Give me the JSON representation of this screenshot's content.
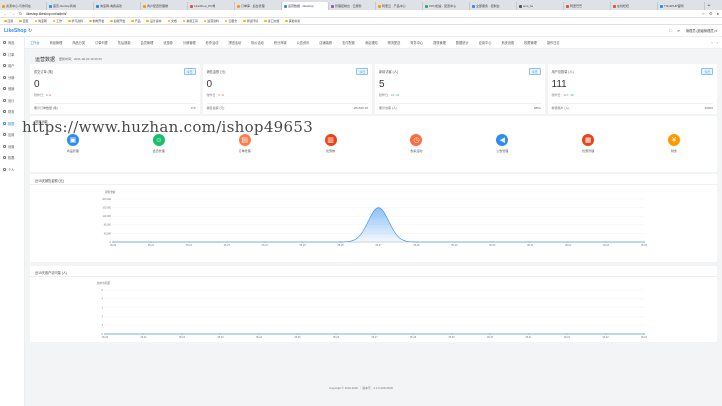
{
  "browser": {
    "tabs": [
      {
        "title": "资源中心-与你同在",
        "color": "#f39c12"
      },
      {
        "title": "首页-Ifoshop商城",
        "color": "#2d8cf0"
      },
      {
        "title": "淘宝网-淘我喜欢",
        "color": "#1e88e5"
      },
      {
        "title": "商户配置管理端",
        "color": "#f39c12"
      },
      {
        "title": "LikeShop_PC端",
        "color": "#e74c3c"
      },
      {
        "title": "订单库 · 后台管理",
        "color": "#f39c12"
      },
      {
        "title": "运营数据 · likeshop",
        "color": "#2d8cf0",
        "active": true
      },
      {
        "title": "管理控制台 · 云服务",
        "color": "#9b59b6"
      },
      {
        "title": "阿里云 · 产品中心",
        "color": "#f39c12"
      },
      {
        "title": "CDN加速 · 配置中心",
        "color": "#27ae60"
      },
      {
        "title": "全部服务 · 控制台",
        "color": "#2d8cf0"
      },
      {
        "title": "sms_fie",
        "color": "#555555"
      },
      {
        "title": "阿里巴巴",
        "color": "#e74c3c"
      },
      {
        "title": "在线旺旺",
        "color": "#e74c3c"
      },
      {
        "title": "ThinkPHP官网",
        "color": "#2d8cf0"
      }
    ],
    "new_tab": "+",
    "url": "likeshop.likeshop.net/admin/",
    "bookmarks": [
      "应用",
      "百度",
      "淘宝网",
      "工作",
      "学习资料",
      "前端开发",
      "后端开发",
      "产品",
      "设计素材",
      "文档",
      "常用工具",
      "运营资料",
      "云服务",
      "测试环境",
      "接口文档",
      "其他书签"
    ]
  },
  "app": {
    "logo": "LikeShop",
    "refresh_icon": "↻",
    "header_right": [
      "⛶",
      "⟳",
      "管理员 (超级管理员) ▾"
    ]
  },
  "sidebar": {
    "items": [
      {
        "label": "商品",
        "active": false
      },
      {
        "label": "订单",
        "active": false
      },
      {
        "label": "用户",
        "active": false
      },
      {
        "label": "分销",
        "active": false
      },
      {
        "label": "营销",
        "active": false
      },
      {
        "label": "设计",
        "active": false
      },
      {
        "label": "财务",
        "active": false
      },
      {
        "label": "数据",
        "active": true
      },
      {
        "label": "应用",
        "active": false
      },
      {
        "label": "设置",
        "active": false
      },
      {
        "label": "权限",
        "active": false
      },
      {
        "label": "个人",
        "active": false
      }
    ]
  },
  "topnav": {
    "items": [
      "工作台",
      "商品管理",
      "商品分类",
      "订单列表",
      "售后退款",
      "会员管理",
      "优惠券",
      "分销管理",
      "秒杀活动",
      "拼团活动",
      "砍价活动",
      "积分商城",
      "公告资讯",
      "店铺装修",
      "支付配置",
      "消息通知",
      "物流配送",
      "财务中心",
      "提现管理",
      "数据统计",
      "应用中心",
      "系统设置",
      "权限管理",
      "操作日志"
    ],
    "active_index": 0
  },
  "overview": {
    "title": "运营数据",
    "updated": "更新时间：2021-06-03 16:26:25",
    "cards": [
      {
        "label": "成交订单 (笔)",
        "tag": "今日",
        "value": "0",
        "compare": "较昨日：0",
        "trend": "-0",
        "trend_dir": "down",
        "foot_label": "累计订单数量 (笔)",
        "foot_value": "170"
      },
      {
        "label": "销售金额 (元)",
        "tag": "今日",
        "value": "0",
        "compare": "较昨日：0",
        "trend": "-0",
        "trend_dir": "down",
        "foot_label": "销售总额 (元)",
        "foot_value": "261535.35"
      },
      {
        "label": "新增访客 (人)",
        "tag": "今日",
        "value": "5",
        "compare": "较昨日：16",
        "trend": "-11",
        "trend_dir": "up",
        "foot_label": "累计访客 (人)",
        "foot_value": "2854"
      },
      {
        "label": "用户总数量 (人)",
        "tag": "今日",
        "value": "111",
        "compare": "较昨日：127",
        "trend": "-16",
        "trend_dir": "up",
        "foot_label": "新增用户 (人)",
        "foot_value": "30600"
      }
    ]
  },
  "shortcuts": {
    "title": "常用功能",
    "items": [
      {
        "label": "商品管理",
        "icon": "bag-icon",
        "glyph": "▣",
        "color": "#2d8cf0"
      },
      {
        "label": "会员管理",
        "icon": "users-icon",
        "glyph": "☺",
        "color": "#19be6b"
      },
      {
        "label": "订单管理",
        "icon": "order-icon",
        "glyph": "▤",
        "color": "#ff7d4d"
      },
      {
        "label": "优惠券",
        "icon": "coupon-icon",
        "glyph": "▥",
        "color": "#ed4014"
      },
      {
        "label": "秒杀活动",
        "icon": "alarm-icon",
        "glyph": "◷",
        "color": "#ff6b3d"
      },
      {
        "label": "公告管理",
        "icon": "speaker-icon",
        "glyph": "◀",
        "color": "#2d8cf0"
      },
      {
        "label": "优惠管理",
        "icon": "gift-icon",
        "glyph": "▦",
        "color": "#ed4014"
      },
      {
        "label": "财务",
        "icon": "money-icon",
        "glyph": "¥",
        "color": "#ff9900"
      }
    ]
  },
  "chart_data": [
    {
      "type": "area",
      "title": "近15天销售金额 (元)",
      "ylabel": "销售金额",
      "x": [
        "05-20",
        "05-21",
        "05-22",
        "05-23",
        "05-24",
        "05-25",
        "05-26",
        "05-27",
        "05-28",
        "05-29",
        "05-30",
        "05-31",
        "06-01",
        "06-02",
        "06-03"
      ],
      "values": [
        0,
        0,
        0,
        0,
        0,
        0,
        0,
        160000,
        0,
        0,
        0,
        0,
        0,
        0,
        0
      ],
      "yticks": [
        0,
        40000,
        80000,
        120000,
        160000,
        200000
      ],
      "yticklabels": [
        "0",
        "40,000",
        "80,000",
        "120,000",
        "160,000",
        "200,000"
      ],
      "ylim": [
        0,
        200000
      ],
      "color": "#2d8cf0"
    },
    {
      "type": "line",
      "title": "近15天用户访问量 (人)",
      "ylabel": "用户访问量",
      "x": [
        "05-20",
        "05-21",
        "05-22",
        "05-23",
        "05-24",
        "05-25",
        "05-26",
        "05-27",
        "05-28",
        "05-29",
        "05-30",
        "05-31",
        "06-01",
        "06-02",
        "06-03"
      ],
      "values": [
        0,
        0,
        0,
        0,
        0,
        0,
        0,
        0,
        0,
        0,
        0,
        0,
        0,
        0,
        0
      ],
      "yticks": [
        0,
        1,
        2,
        3,
        4,
        5
      ],
      "yticklabels": [
        "0",
        "1",
        "2",
        "3",
        "4",
        "5"
      ],
      "ylim": [
        0,
        5
      ],
      "color": "#2d8cf0"
    }
  ],
  "footer": "Copyright © 2019-2020 ｜ 版本号：2.4.5.20210526",
  "watermark": "https://www.huzhan.com/ishop49653"
}
